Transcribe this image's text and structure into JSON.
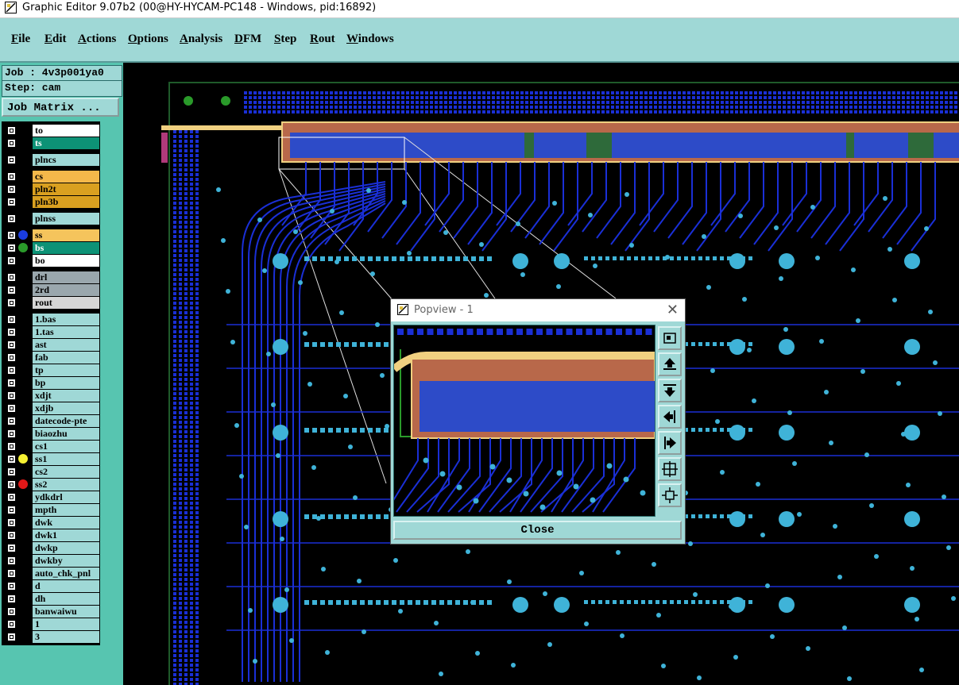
{
  "window": {
    "title": "Graphic Editor 9.07b2 (00@HY-HYCAM-PC148 - Windows, pid:16892)"
  },
  "menu": [
    "File",
    "Edit",
    "Actions",
    "Options",
    "Analysis",
    "DFM",
    "Step",
    "Rout",
    "Windows"
  ],
  "job": {
    "job_line": "Job : 4v3p001ya0",
    "step_line": "Step: cam",
    "matrix_button": "Job Matrix ..."
  },
  "layers": [
    {
      "name": "to",
      "bg": "#ffffff",
      "fg": "#000000",
      "dot": ""
    },
    {
      "name": "ts",
      "bg": "#0d9276",
      "fg": "#ffffff",
      "dot": ""
    },
    {
      "name": "plncs",
      "bg": "#9fd8d6",
      "fg": "#000000",
      "dot": ""
    },
    {
      "name": "cs",
      "bg": "#f5b84a",
      "fg": "#000000",
      "dot": ""
    },
    {
      "name": "pln2t",
      "bg": "#d9a020",
      "fg": "#000000",
      "dot": ""
    },
    {
      "name": "pln3b",
      "bg": "#d9a020",
      "fg": "#000000",
      "dot": ""
    },
    {
      "name": "plnss",
      "bg": "#9fd8d6",
      "fg": "#000000",
      "dot": ""
    },
    {
      "name": "ss",
      "bg": "#f5c45c",
      "fg": "#000000",
      "dot": "#1a3de0"
    },
    {
      "name": "bs",
      "bg": "#0d9276",
      "fg": "#ffffff",
      "dot": "#2a9a2a"
    },
    {
      "name": "bo",
      "bg": "#ffffff",
      "fg": "#000000",
      "dot": ""
    },
    {
      "name": "drl",
      "bg": "#9aa7ad",
      "fg": "#000000",
      "dot": ""
    },
    {
      "name": "2rd",
      "bg": "#9aa7ad",
      "fg": "#000000",
      "dot": ""
    },
    {
      "name": "rout",
      "bg": "#d6d6d6",
      "fg": "#000000",
      "dot": ""
    },
    {
      "name": "1.bas",
      "bg": "#9fd8d6",
      "fg": "#000000",
      "dot": ""
    },
    {
      "name": "1.tas",
      "bg": "#9fd8d6",
      "fg": "#000000",
      "dot": ""
    },
    {
      "name": "ast",
      "bg": "#9fd8d6",
      "fg": "#000000",
      "dot": ""
    },
    {
      "name": "fab",
      "bg": "#9fd8d6",
      "fg": "#000000",
      "dot": ""
    },
    {
      "name": "tp",
      "bg": "#9fd8d6",
      "fg": "#000000",
      "dot": ""
    },
    {
      "name": "bp",
      "bg": "#9fd8d6",
      "fg": "#000000",
      "dot": ""
    },
    {
      "name": "xdjt",
      "bg": "#9fd8d6",
      "fg": "#000000",
      "dot": ""
    },
    {
      "name": "xdjb",
      "bg": "#9fd8d6",
      "fg": "#000000",
      "dot": ""
    },
    {
      "name": "datecode-pte",
      "bg": "#9fd8d6",
      "fg": "#000000",
      "dot": ""
    },
    {
      "name": "biaozhu",
      "bg": "#9fd8d6",
      "fg": "#000000",
      "dot": ""
    },
    {
      "name": "cs1",
      "bg": "#9fd8d6",
      "fg": "#000000",
      "dot": ""
    },
    {
      "name": "ss1",
      "bg": "#9fd8d6",
      "fg": "#000000",
      "dot": "#f5f032"
    },
    {
      "name": "cs2",
      "bg": "#9fd8d6",
      "fg": "#000000",
      "dot": ""
    },
    {
      "name": "ss2",
      "bg": "#9fd8d6",
      "fg": "#000000",
      "dot": "#e01818"
    },
    {
      "name": "ydkdrl",
      "bg": "#9fd8d6",
      "fg": "#000000",
      "dot": ""
    },
    {
      "name": "mpth",
      "bg": "#9fd8d6",
      "fg": "#000000",
      "dot": ""
    },
    {
      "name": "dwk",
      "bg": "#9fd8d6",
      "fg": "#000000",
      "dot": ""
    },
    {
      "name": "dwk1",
      "bg": "#9fd8d6",
      "fg": "#000000",
      "dot": ""
    },
    {
      "name": "dwkp",
      "bg": "#9fd8d6",
      "fg": "#000000",
      "dot": ""
    },
    {
      "name": "dwkby",
      "bg": "#9fd8d6",
      "fg": "#000000",
      "dot": ""
    },
    {
      "name": "auto_chk_pnl",
      "bg": "#9fd8d6",
      "fg": "#000000",
      "dot": ""
    },
    {
      "name": "d",
      "bg": "#9fd8d6",
      "fg": "#000000",
      "dot": ""
    },
    {
      "name": "dh",
      "bg": "#9fd8d6",
      "fg": "#000000",
      "dot": ""
    },
    {
      "name": "banwaiwu",
      "bg": "#9fd8d6",
      "fg": "#000000",
      "dot": ""
    },
    {
      "name": "1",
      "bg": "#9fd8d6",
      "fg": "#000000",
      "dot": ""
    },
    {
      "name": "3",
      "bg": "#9fd8d6",
      "fg": "#000000",
      "dot": ""
    }
  ],
  "popview": {
    "title": "Popview - 1",
    "close_label": "Close"
  },
  "colors": {
    "panel": "#9fd8d6",
    "panel_dark": "#57c5b0",
    "trace": "#1a2fd6",
    "pad": "#3fb3d8",
    "copper": "#b8684a"
  }
}
